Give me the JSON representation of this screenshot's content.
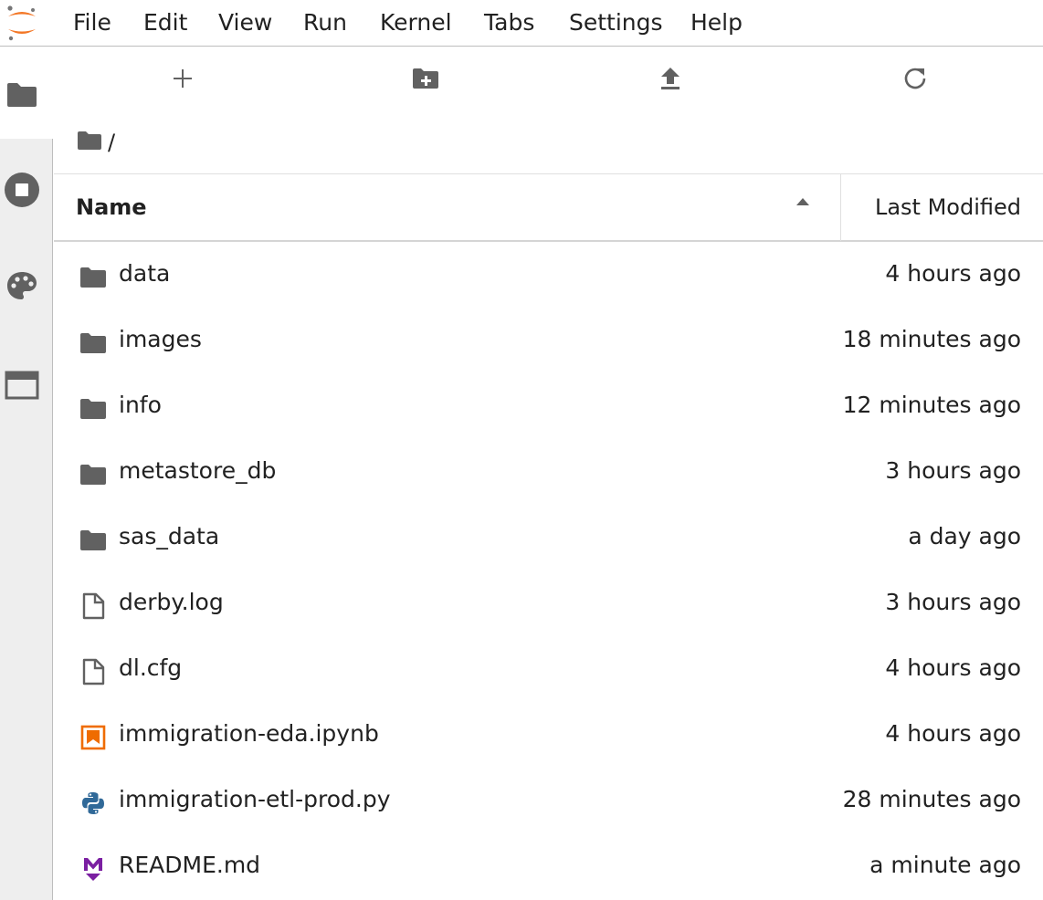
{
  "menu": {
    "items": [
      "File",
      "Edit",
      "View",
      "Run",
      "Kernel",
      "Tabs",
      "Settings",
      "Help"
    ]
  },
  "sidebar": {
    "tabs": [
      {
        "icon": "folder-icon",
        "active": true
      },
      {
        "icon": "stop-circle-icon",
        "active": false
      },
      {
        "icon": "palette-icon",
        "active": false
      },
      {
        "icon": "tab-window-icon",
        "active": false
      }
    ]
  },
  "toolbar": {
    "buttons": [
      {
        "icon": "plus-icon"
      },
      {
        "icon": "new-folder-icon"
      },
      {
        "icon": "upload-icon"
      },
      {
        "icon": "refresh-icon"
      }
    ]
  },
  "breadcrumb": {
    "separator": "/"
  },
  "listing": {
    "header": {
      "name": "Name",
      "modified": "Last Modified",
      "sort": "ascending"
    },
    "rows": [
      {
        "type": "folder",
        "name": "data",
        "modified": "4 hours ago"
      },
      {
        "type": "folder",
        "name": "images",
        "modified": "18 minutes ago"
      },
      {
        "type": "folder",
        "name": "info",
        "modified": "12 minutes ago"
      },
      {
        "type": "folder",
        "name": "metastore_db",
        "modified": "3 hours ago"
      },
      {
        "type": "folder",
        "name": "sas_data",
        "modified": "a day ago"
      },
      {
        "type": "file",
        "name": "derby.log",
        "modified": "3 hours ago"
      },
      {
        "type": "file",
        "name": "dl.cfg",
        "modified": "4 hours ago"
      },
      {
        "type": "notebook",
        "name": "immigration-eda.ipynb",
        "modified": "4 hours ago"
      },
      {
        "type": "python",
        "name": "immigration-etl-prod.py",
        "modified": "28 minutes ago"
      },
      {
        "type": "markdown",
        "name": "README.md",
        "modified": "a minute ago"
      }
    ]
  },
  "colors": {
    "icon_gray": "#616161",
    "jupyter_orange": "#f37726",
    "notebook_orange": "#ef6c00",
    "python_blue": "#306998",
    "python_yellow": "#ffd43b",
    "markdown_purple": "#7b1fa2"
  }
}
